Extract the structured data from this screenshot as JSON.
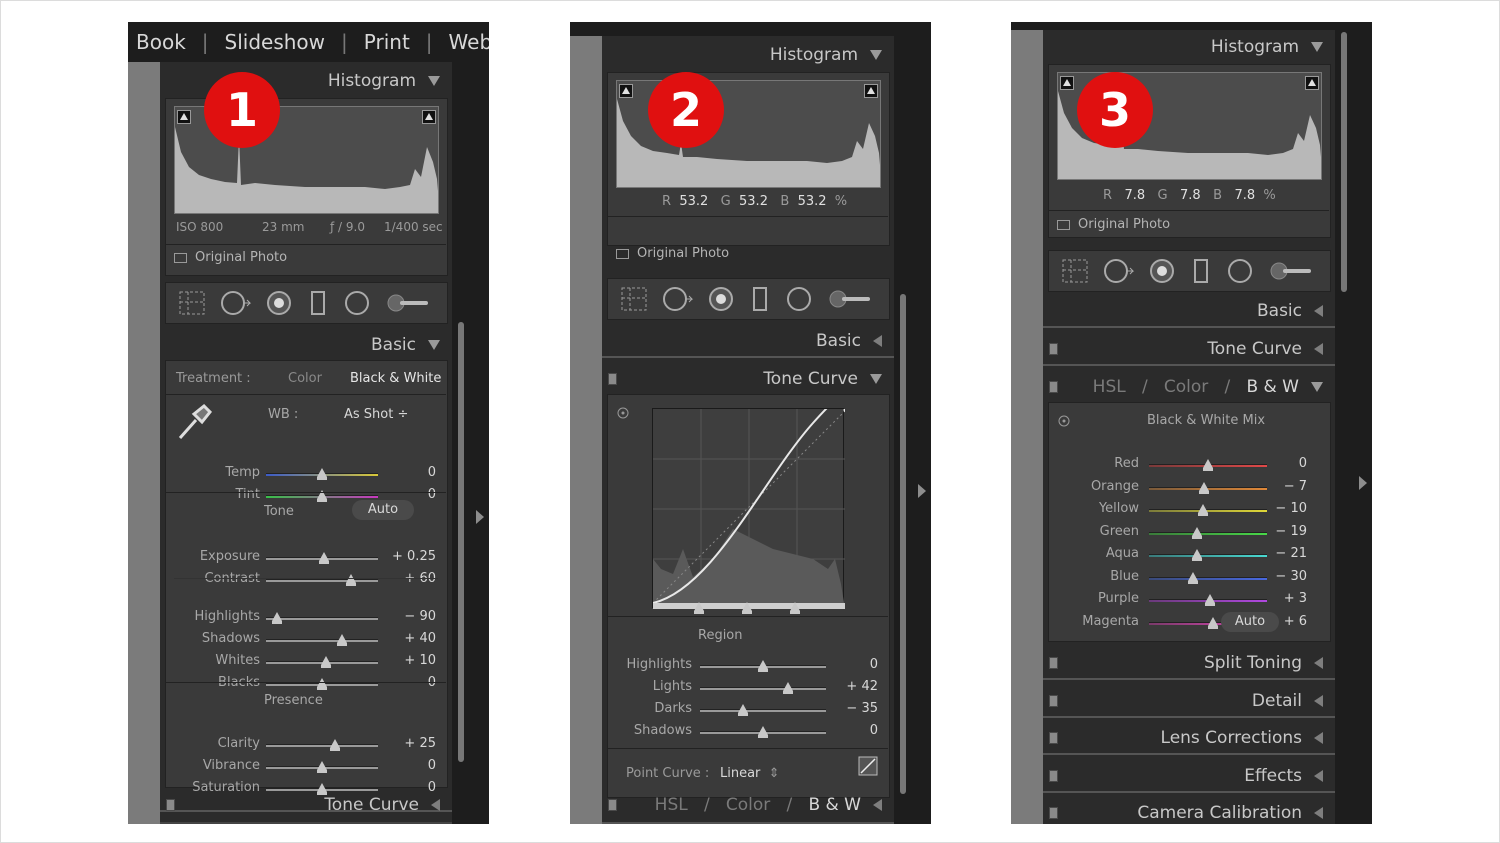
{
  "colors": {
    "badge": "#e01010",
    "panel_bg": "#2b2b2b",
    "frame_dark": "#1d1d1d"
  },
  "panel1": {
    "module_tabs": [
      "Book",
      "Slideshow",
      "Print",
      "Web"
    ],
    "badge": "1",
    "histogram": "Histogram",
    "exif": {
      "iso": "ISO 800",
      "focal": "23 mm",
      "aperture": "ƒ / 9.0",
      "shutter": "1/400 sec"
    },
    "original_photo": "Original Photo",
    "basic": "Basic",
    "treatment": {
      "label": "Treatment :",
      "color": "Color",
      "bw": "Black & White"
    },
    "wb": {
      "label": "WB :",
      "value": "As Shot ÷"
    },
    "wb_sliders": [
      {
        "label": "Temp",
        "value": "0",
        "pos": 0.5,
        "grad": "linear-gradient(90deg,#3b5bc8,#d8c838)"
      },
      {
        "label": "Tint",
        "value": "0",
        "pos": 0.5,
        "grad": "linear-gradient(90deg,#38c048,#c838c0)"
      }
    ],
    "tone": {
      "label": "Tone",
      "auto": "Auto"
    },
    "tone_sliders": [
      {
        "label": "Exposure",
        "value": "+ 0.25",
        "pos": 0.52
      },
      {
        "label": "Contrast",
        "value": "+ 60",
        "pos": 0.76
      }
    ],
    "tone2_sliders": [
      {
        "label": "Highlights",
        "value": "− 90",
        "pos": 0.1
      },
      {
        "label": "Shadows",
        "value": "+ 40",
        "pos": 0.68
      },
      {
        "label": "Whites",
        "value": "+ 10",
        "pos": 0.54
      },
      {
        "label": "Blacks",
        "value": "0",
        "pos": 0.5
      }
    ],
    "presence": "Presence",
    "presence_sliders": [
      {
        "label": "Clarity",
        "value": "+ 25",
        "pos": 0.62
      },
      {
        "label": "Vibrance",
        "value": "0",
        "pos": 0.5
      },
      {
        "label": "Saturation",
        "value": "0",
        "pos": 0.5
      }
    ],
    "tone_curve": "Tone Curve"
  },
  "panel2": {
    "badge": "2",
    "histogram": "Histogram",
    "rgb": {
      "r": "R",
      "rv": "53.2",
      "g": "G",
      "gv": "53.2",
      "b": "B",
      "bv": "53.2",
      "pct": "%"
    },
    "original_photo": "Original Photo",
    "basic": "Basic",
    "tone_curve": "Tone Curve",
    "region": "Region",
    "region_sliders": [
      {
        "label": "Highlights",
        "value": "0",
        "pos": 0.5
      },
      {
        "label": "Lights",
        "value": "+ 42",
        "pos": 0.7
      },
      {
        "label": "Darks",
        "value": "− 35",
        "pos": 0.34
      },
      {
        "label": "Shadows",
        "value": "0",
        "pos": 0.5
      }
    ],
    "point_curve": {
      "label": "Point Curve :",
      "value": "Linear"
    },
    "hsl": {
      "h": "HSL",
      "sep": "/",
      "c": "Color",
      "bw": "B & W"
    }
  },
  "panel3": {
    "badge": "3",
    "histogram": "Histogram",
    "rgb": {
      "r": "R",
      "rv": "7.8",
      "g": "G",
      "gv": "7.8",
      "b": "B",
      "bv": "7.8",
      "pct": "%"
    },
    "original_photo": "Original Photo",
    "basic": "Basic",
    "tone_curve": "Tone Curve",
    "hsl": {
      "h": "HSL",
      "sep": "/",
      "c": "Color",
      "bw": "B & W"
    },
    "mix_title": "Black & White Mix",
    "mix_sliders": [
      {
        "label": "Red",
        "value": "0",
        "pos": 0.5,
        "grad": "linear-gradient(90deg,#7a3a3a,#e04848)"
      },
      {
        "label": "Orange",
        "value": "− 7",
        "pos": 0.47,
        "grad": "linear-gradient(90deg,#7a5a3a,#e08838)"
      },
      {
        "label": "Yellow",
        "value": "− 10",
        "pos": 0.46,
        "grad": "linear-gradient(90deg,#7a7a3a,#e0d838)"
      },
      {
        "label": "Green",
        "value": "− 19",
        "pos": 0.41,
        "grad": "linear-gradient(90deg,#3a7a3a,#48d848)"
      },
      {
        "label": "Aqua",
        "value": "− 21",
        "pos": 0.41,
        "grad": "linear-gradient(90deg,#3a7a7a,#48d8d0)"
      },
      {
        "label": "Blue",
        "value": "− 30",
        "pos": 0.37,
        "grad": "linear-gradient(90deg,#3a4a7a,#4868e0)"
      },
      {
        "label": "Purple",
        "value": "+ 3",
        "pos": 0.52,
        "grad": "linear-gradient(90deg,#6a3a7a,#b048e0)"
      },
      {
        "label": "Magenta",
        "value": "+ 6",
        "pos": 0.54,
        "grad": "linear-gradient(90deg,#7a3a6a,#e048b8)"
      }
    ],
    "auto": "Auto",
    "sections": [
      "Split Toning",
      "Detail",
      "Lens Corrections",
      "Effects",
      "Camera Calibration"
    ]
  }
}
